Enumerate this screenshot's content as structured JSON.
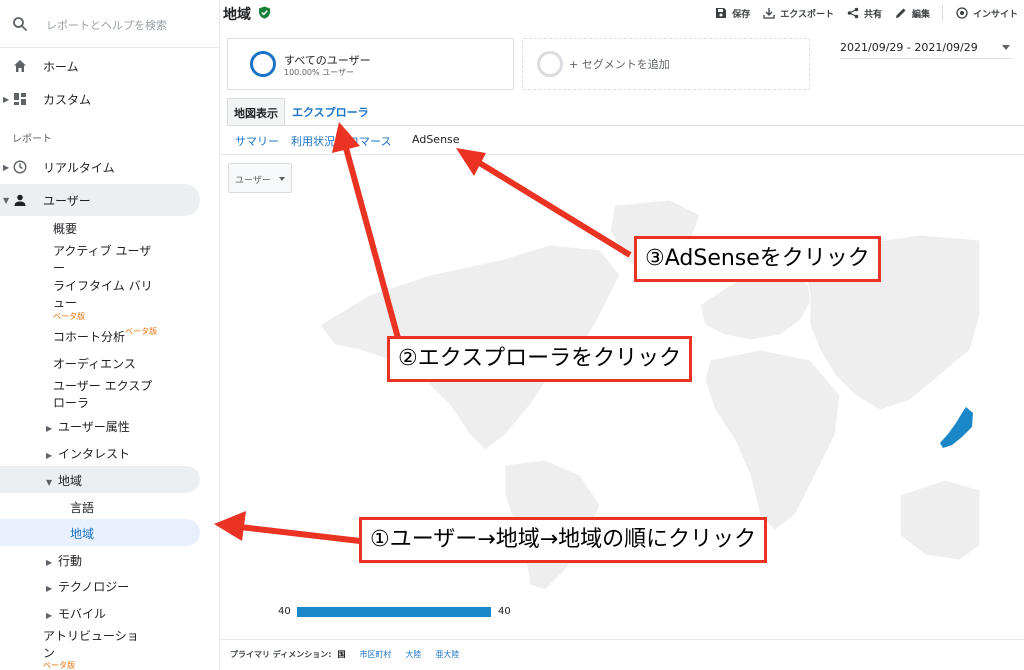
{
  "sidebar": {
    "search_placeholder": "レポートとヘルプを検索",
    "home": "ホーム",
    "custom": "カスタム",
    "section_reports": "レポート",
    "realtime": "リアルタイム",
    "users": "ユーザー",
    "users_sub": {
      "overview": "概要",
      "active_users_1": "アクティブ ユーザ",
      "active_users_2": "ー",
      "lifetime_1": "ライフタイム バリ",
      "lifetime_2": "ュー",
      "beta": "ベータ版",
      "cohort": "コホート分析",
      "audience": "オーディエンス",
      "explorer_1": "ユーザー エクスプ",
      "explorer_2": "ローラ",
      "demographics": "ユーザー属性",
      "interests": "インタレスト",
      "geo": "地域",
      "geo_language": "言語",
      "geo_location": "地域",
      "behavior": "行動",
      "technology": "テクノロジー",
      "mobile": "モバイル"
    },
    "attribution_1": "アトリビューショ",
    "attribution_2": "ン"
  },
  "header": {
    "title": "地域",
    "toolbar": {
      "save": "保存",
      "export": "エクスポート",
      "share": "共有",
      "edit": "編集",
      "insight": "インサイト"
    }
  },
  "segments": {
    "all_users": "すべてのユーザー",
    "all_users_pct": "100.00% ユーザー",
    "add_segment": "+ セグメントを追加"
  },
  "date_range": "2021/09/29 - 2021/09/29",
  "tabs": {
    "map_view": "地図表示",
    "explorer": "エクスプローラ"
  },
  "subnav": {
    "summary": "サマリー",
    "usage": "利用状況",
    "ecommerce": "コマース",
    "adsense": "AdSense"
  },
  "metric_select": "ユーザー",
  "legend": {
    "min": "40",
    "max": "40"
  },
  "dimensions": {
    "label": "プライマリ ディメンション:",
    "country": "国",
    "city": "市区町村",
    "continent": "大陸",
    "subcontinent": "亜大陸"
  },
  "annotations": {
    "step1": "①ユーザー→地域→地域の順にクリック",
    "step2": "②エクスプローラをクリック",
    "step3": "③AdSenseをクリック"
  },
  "colors": {
    "accent": "#1a73c6",
    "annotation_red": "#ea3323",
    "map_highlight": "#1a87c8"
  }
}
